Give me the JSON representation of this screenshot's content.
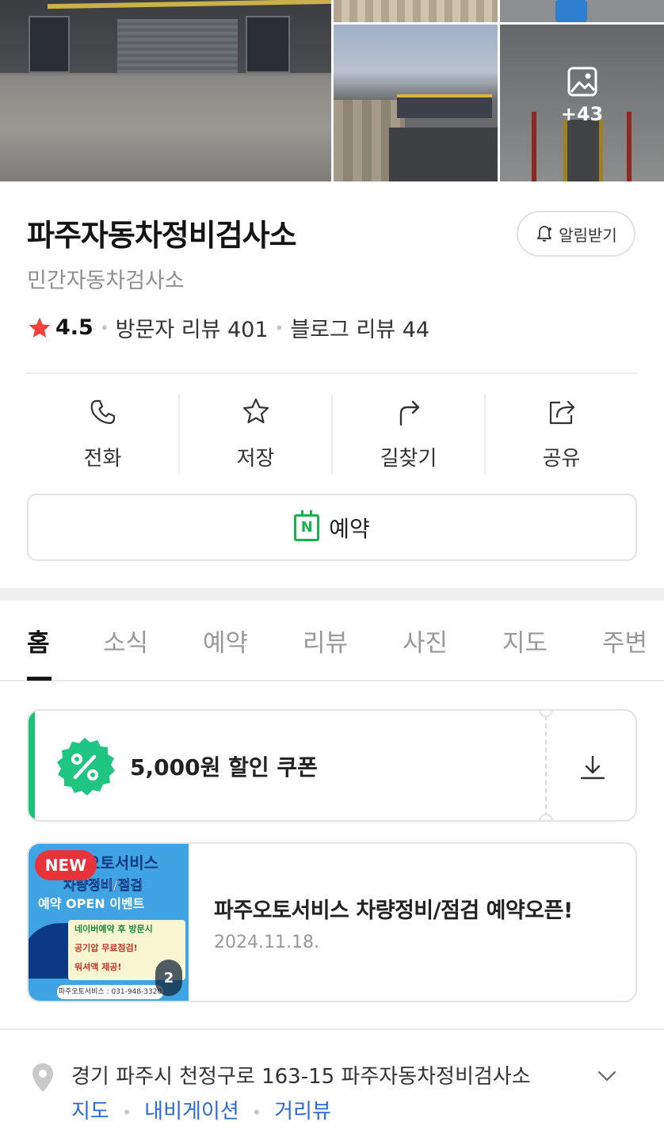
{
  "gallery": {
    "more_count": "+43"
  },
  "place": {
    "name": "파주자동차정비검사소",
    "category": "민간자동차검사소",
    "rating": "4.5",
    "visitor_reviews": "방문자 리뷰 401",
    "blog_reviews": "블로그 리뷰 44",
    "alarm_label": "알림받기"
  },
  "actions": [
    {
      "label": "전화",
      "icon": "phone-icon"
    },
    {
      "label": "저장",
      "icon": "star-icon"
    },
    {
      "label": "길찾기",
      "icon": "directions-icon"
    },
    {
      "label": "공유",
      "icon": "share-icon"
    }
  ],
  "booking": {
    "label": "예약",
    "icon_text": "N"
  },
  "tabs": [
    "홈",
    "소식",
    "예약",
    "리뷰",
    "사진",
    "지도",
    "주변"
  ],
  "coupon": {
    "text": "5,000원 할인 쿠폰"
  },
  "news": {
    "badge": "NEW",
    "count": "2",
    "title": "파주오토서비스 차량정비/점검 예약오픈!",
    "date": "2024.11.18.",
    "thumb": {
      "line1": "오토서비스",
      "line2": "차량정비/점검",
      "line3": "예약 OPEN 이벤트",
      "note1": "네이버예약 후 방문시",
      "note2": "공기압 무료점검!",
      "note3": "워셔액 제공!",
      "footer": "파주오토서비스 : 031-948-3320"
    }
  },
  "address": {
    "text": "경기 파주시 천정구로 163-15 파주자동차정비검사소",
    "links": [
      "지도",
      "내비게이션",
      "거리뷰"
    ]
  },
  "colors": {
    "accent_green": "#19b04f",
    "link_blue": "#2a6ad8",
    "star_red": "#f2403c",
    "badge_red": "#e8323c"
  }
}
